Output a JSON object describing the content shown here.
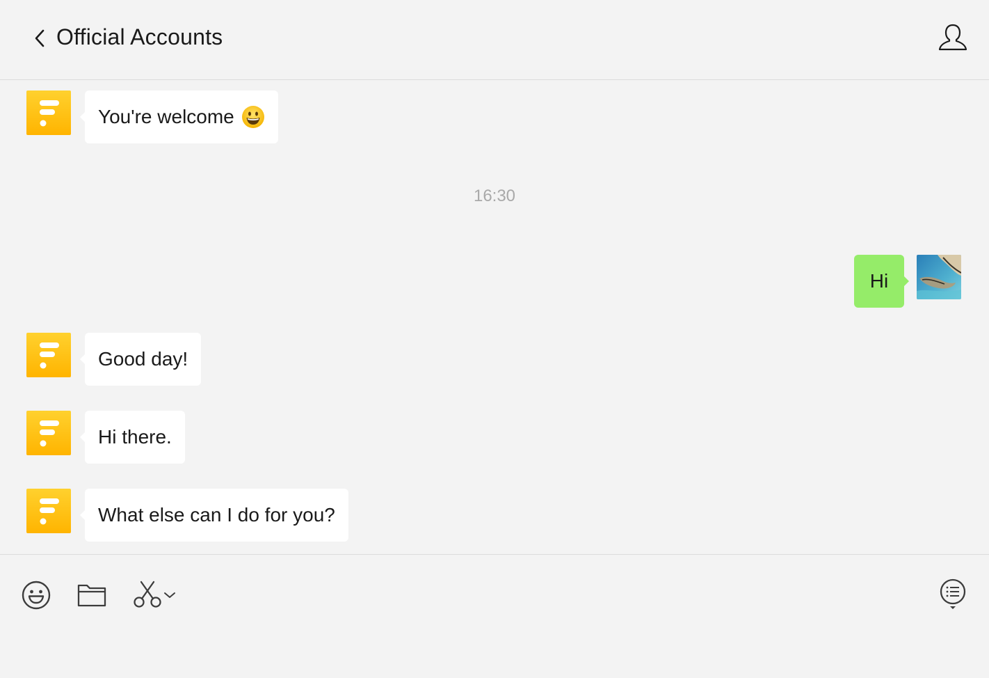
{
  "header": {
    "title": "Official Accounts",
    "back_icon": "chevron-left-icon",
    "profile_icon": "person-icon"
  },
  "messages": [
    {
      "from": "official-account",
      "text": "You're welcome",
      "emoji": "grinning-face"
    },
    {
      "type": "timestamp",
      "text": "16:30"
    },
    {
      "from": "me",
      "text": "Hi"
    },
    {
      "from": "official-account",
      "text": "Good day!"
    },
    {
      "from": "official-account",
      "text": "Hi there."
    },
    {
      "from": "official-account",
      "text": "What else can I do for you?"
    }
  ],
  "toolbar": {
    "emoji_icon": "smiley-icon",
    "file_icon": "folder-icon",
    "screenshot_icon": "scissors-icon",
    "screenshot_menu_icon": "chevron-down-icon",
    "chat_history_icon": "chat-history-icon"
  },
  "colors": {
    "background": "#f3f3f3",
    "incoming_bubble": "#ffffff",
    "outgoing_bubble": "#95ec69",
    "bot_avatar_top": "#ffd12e",
    "bot_avatar_bottom": "#ffb400",
    "timestamp_text": "#a9a9a9",
    "divider": "#dcdcdc"
  }
}
